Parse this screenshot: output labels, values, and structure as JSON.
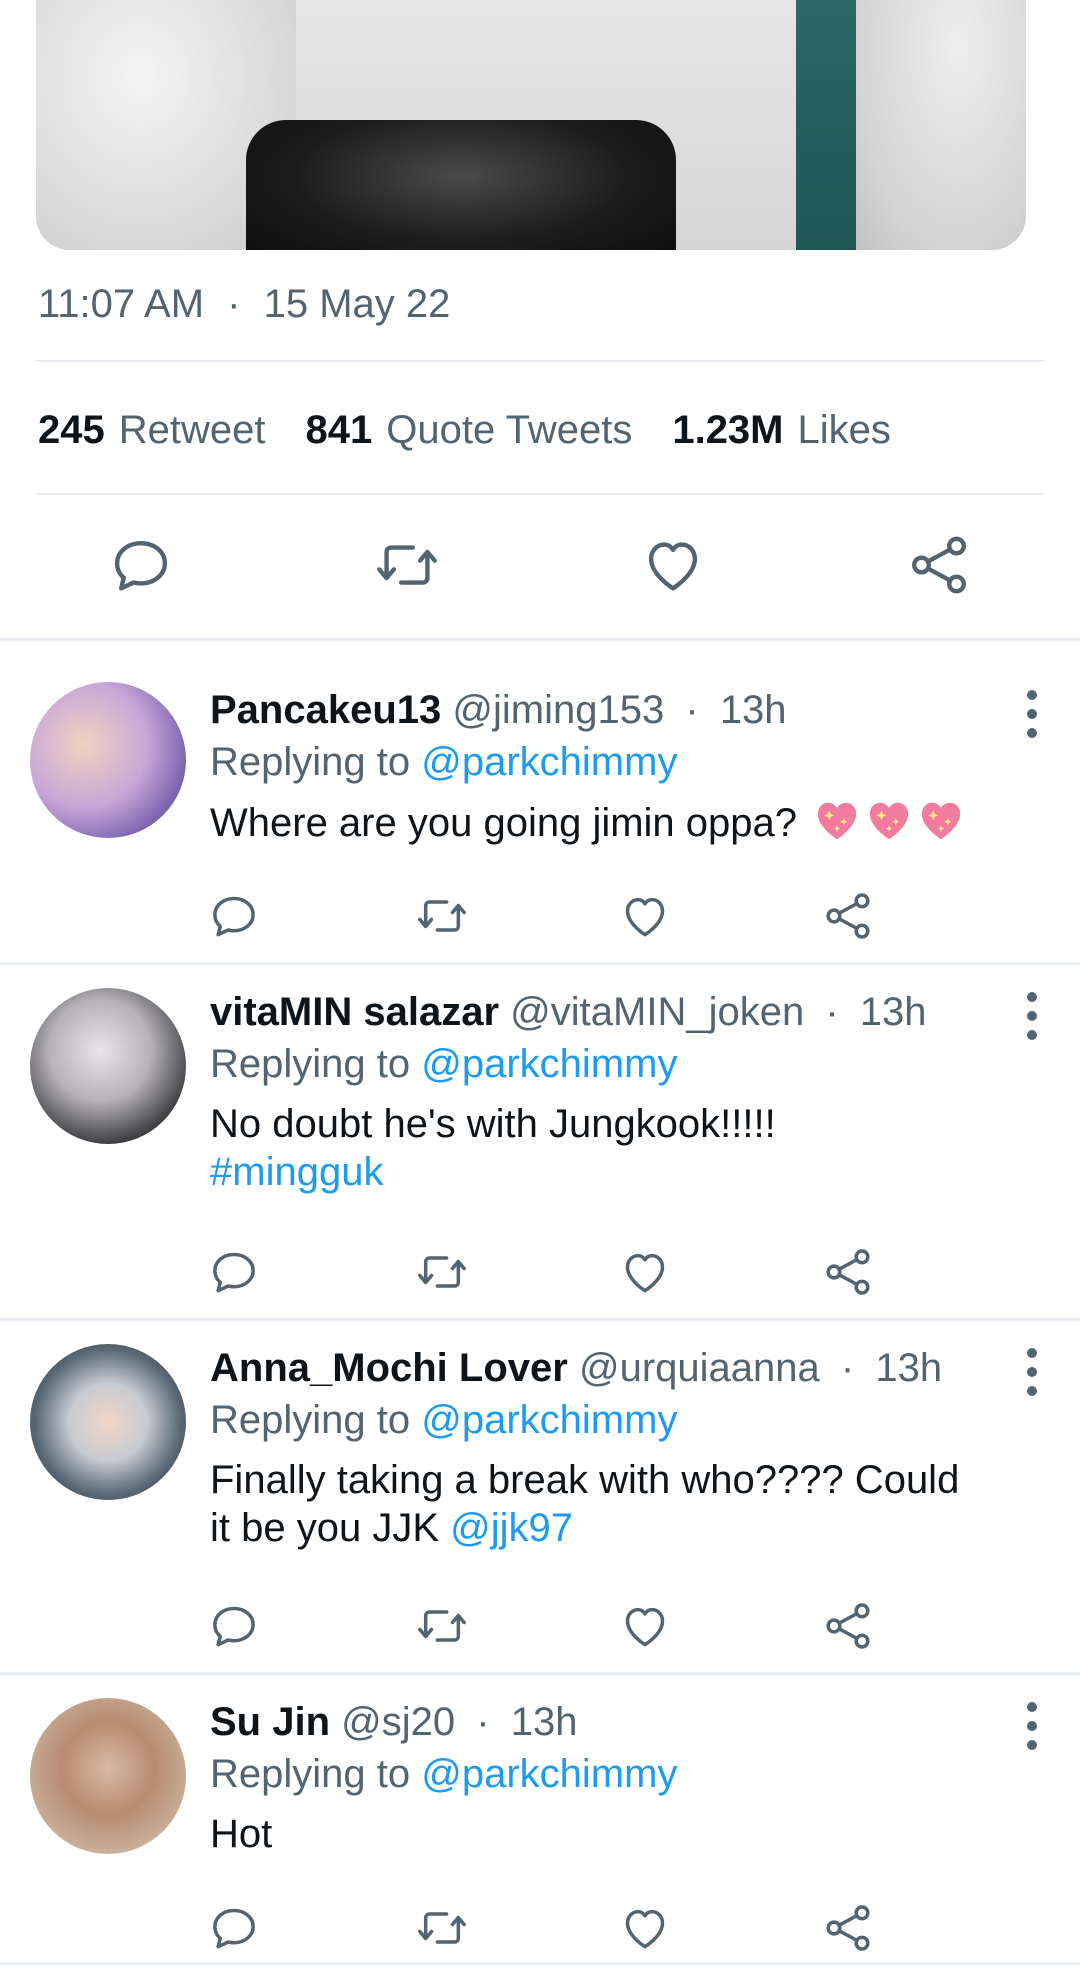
{
  "tweet": {
    "time": "11:07 AM",
    "date": "15 May 22",
    "retweets_count": "245",
    "retweets_label": "Retweet",
    "quotes_count": "841",
    "quotes_label": "Quote Tweets",
    "likes_count": "1.23M",
    "likes_label": "Likes"
  },
  "icons": {
    "reply": "reply-icon",
    "retweet": "retweet-icon",
    "like": "heart-icon",
    "share": "share-icon",
    "more": "more-vertical-icon"
  },
  "colors": {
    "text": "#0f1419",
    "secondary": "#536471",
    "link": "#1d9bf0",
    "divider": "#e6ecf0"
  },
  "replies": [
    {
      "name": "Pancakeu13",
      "handle": "@jiming153",
      "time": "13h",
      "replying_prefix": "Replying to",
      "replying_to": "@parkchimmy",
      "text": "Where are you going jimin oppa?",
      "emoji": "sparkling-heart-emoji x3"
    },
    {
      "name": "vitaMIN salazar",
      "handle": "@vitaMIN_joken",
      "time": "13h",
      "replying_prefix": "Replying to",
      "replying_to": "@parkchimmy",
      "text": "No doubt he's with Jungkook!!!!!",
      "hashtag": "#mingguk"
    },
    {
      "name": "Anna_Mochi Lover",
      "handle": "@urquiaanna",
      "time": "13h",
      "replying_prefix": "Replying to",
      "replying_to": "@parkchimmy",
      "text_line1": "Finally taking a break with who???? Could",
      "text_line2": "it be you JJK",
      "mention": "@jjk97"
    },
    {
      "name": "Su Jin",
      "handle": "@sj20",
      "time": "13h",
      "replying_prefix": "Replying to",
      "replying_to": "@parkchimmy",
      "text": "Hot"
    }
  ],
  "separator": "·"
}
